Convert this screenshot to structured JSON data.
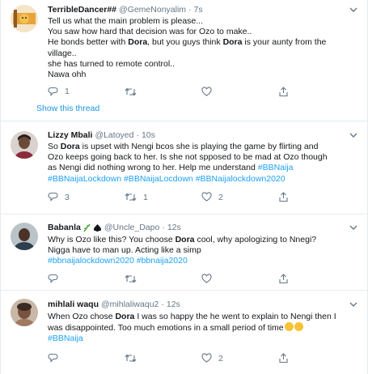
{
  "tweets": [
    {
      "name": "TerribleDancer##",
      "handle": "@GemeNonyalim",
      "time": "7s",
      "avatar": "cartoon-flag-avatar",
      "lines": [
        {
          "a": "Tell us what the main problem is please..."
        },
        {
          "a": " You saw how hard that decision was for Ozo to make.."
        },
        {
          "a": "He bonds better with ",
          "b": "Dora",
          "c": ", but you guys think ",
          "d": "Dora",
          "e": " is your aunty from the"
        },
        {
          "a": "village.."
        },
        {
          "a": " she has turned to remote control.."
        },
        {
          "a": "Nawa ohh"
        }
      ],
      "reply_count": "1",
      "retweet_count": "",
      "like_count": "",
      "show_thread": "Show this thread"
    },
    {
      "name": "Lizzy Mbali",
      "handle": "@Latoyed",
      "time": "10s",
      "avatar": "person-photo-avatar",
      "lines": [
        {
          "a": "So ",
          "b": "Dora",
          "c": " is upset with Nengi bcos she is playing the game by flirting and"
        },
        {
          "a": "Ozo keeps going back to her. Is she not spposed to be mad at Ozo though"
        },
        {
          "a": "as Nengi did nothing wrong to her. Help me understand ",
          "t": "#BBNaija"
        },
        {
          "t": "#BBNaijaLockdown #BBNaijaLocdown #BBNaijalockdown2020"
        }
      ],
      "reply_count": "3",
      "retweet_count": "1",
      "like_count": "2"
    },
    {
      "name": "Babanla",
      "handle": "@Uncle_Dapo",
      "time": "12s",
      "avatar": "person-photo-avatar",
      "name_icons": [
        "herb-emoji",
        "spade-icon"
      ],
      "lines": [
        {
          "a": "Why is Ozo like this? You choose ",
          "b": "Dora",
          "c": " cool, why apologizing to Nnegi?"
        },
        {
          "a": "Nigga have to man up. Acting like a simp"
        },
        {
          "t": "#bbnaijalockdown2020 #bbnaija2020"
        }
      ],
      "reply_count": "",
      "retweet_count": "",
      "like_count": ""
    },
    {
      "name": "mihlali waqu",
      "handle": "@mihlaliwaqu2",
      "time": "12s",
      "avatar": "person-photo-avatar",
      "lines": [
        {
          "a": "When Ozo chose ",
          "b": "Dora",
          "c": " I was so happy the he went to explain to Nengi then I"
        },
        {
          "a": "was disappointed. Too much emotions in a small period of time",
          "emoji": "weary-face-emoji"
        },
        {
          "t": "#BBNaija"
        }
      ],
      "reply_count": "",
      "retweet_count": "",
      "like_count": "2"
    }
  ],
  "colors": {
    "link": "#1da1f2",
    "muted": "#657786",
    "divider": "#e6ecf0"
  }
}
